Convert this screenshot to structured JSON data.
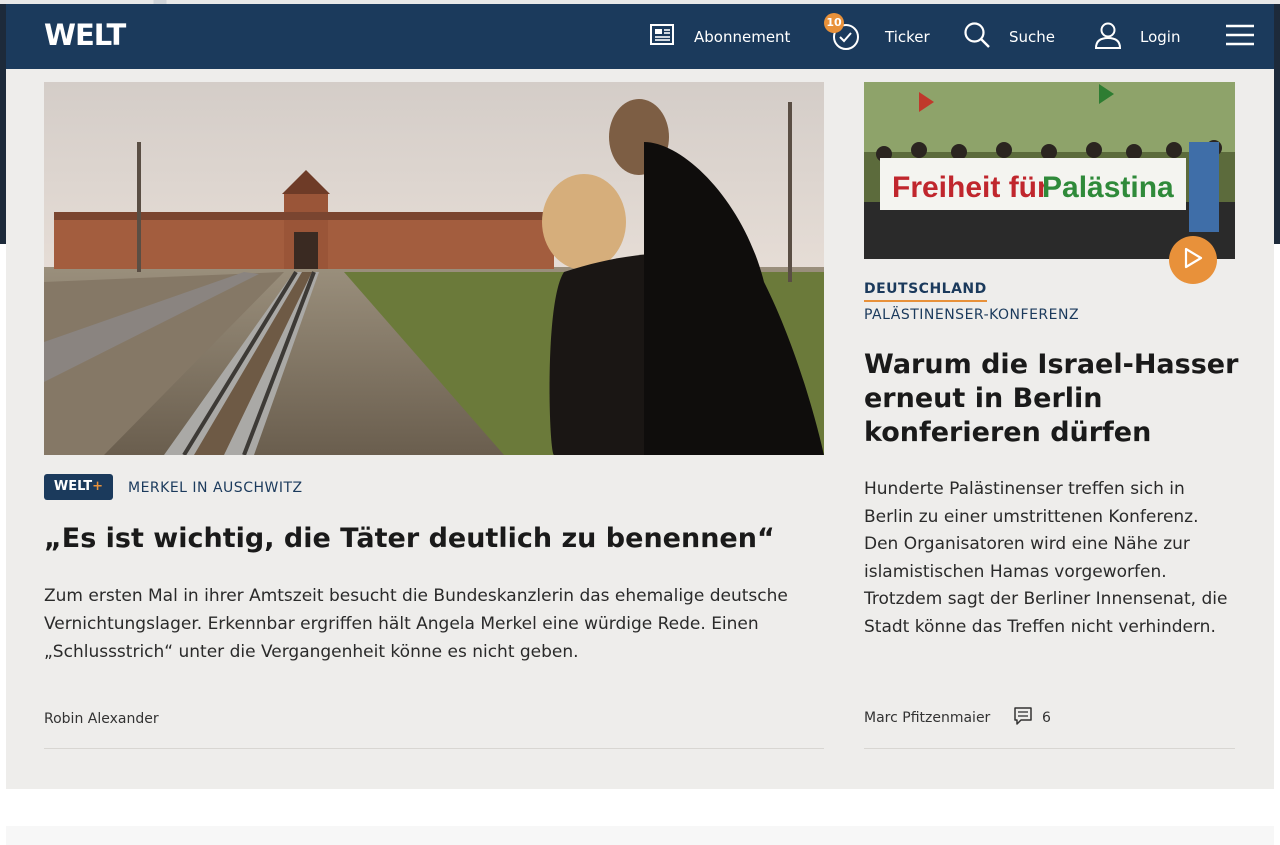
{
  "header": {
    "logo": "WELT",
    "nav": {
      "abonnement": "Abonnement",
      "ticker": "Ticker",
      "ticker_count": "10",
      "suche": "Suche",
      "login": "Login"
    }
  },
  "lead_article": {
    "badge": {
      "text": "WELT",
      "plus": "+"
    },
    "kicker": "MERKEL IN AUSCHWITZ",
    "headline": "„Es ist wichtig, die Täter deutlich zu benennen“",
    "teaser": "Zum ersten Mal in ihrer Amtszeit besucht die Bundeskanzlerin das ehemalige deutsche Vernichtungslager. Erkennbar ergriffen hält Angela Merkel eine würdige Rede. Einen „Schlussstrich“ unter die Vergangenheit könne es nicht geben.",
    "author": "Robin Alexander"
  },
  "side_article": {
    "image_banner_text": "Freiheit für Palästina",
    "rubric": "DEUTSCHLAND",
    "kicker": "PALÄSTINENSER-KONFERENZ",
    "headline": "Warum die Israel-Hasser erneut in Berlin konferieren dürfen",
    "teaser": "Hunderte Palästinenser treffen sich in Berlin zu einer umstrittenen Konferenz. Den Organisatoren wird eine Nähe zur islamistischen Hamas vorgeworfen. Trotzdem sagt der Berliner Innensenat, die Stadt könne das Treffen nicht verhindern.",
    "author": "Marc Pfitzenmaier",
    "comment_count": "6"
  },
  "colors": {
    "brand_blue": "#1b3a5c",
    "accent_orange": "#e8913a",
    "page_bg": "#eeedeb"
  }
}
